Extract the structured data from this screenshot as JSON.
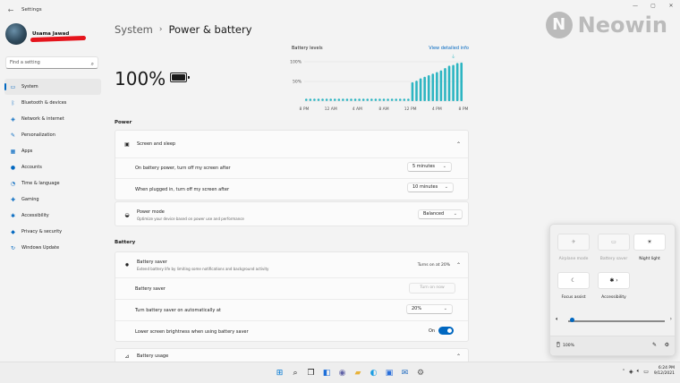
{
  "window": {
    "title": "Settings",
    "back_icon": "back-arrow-icon",
    "controls": [
      "—",
      "▢",
      "✕"
    ]
  },
  "user": {
    "name": "Usama Jawad"
  },
  "search": {
    "placeholder": "Find a setting"
  },
  "nav": {
    "items": [
      {
        "label": "System",
        "icon": "monitor-icon",
        "glyph": "▭",
        "active": true
      },
      {
        "label": "Bluetooth & devices",
        "icon": "bluetooth-icon",
        "glyph": "ᛒ"
      },
      {
        "label": "Network & internet",
        "icon": "wifi-icon",
        "glyph": "◈"
      },
      {
        "label": "Personalization",
        "icon": "brush-icon",
        "glyph": "✎"
      },
      {
        "label": "Apps",
        "icon": "apps-icon",
        "glyph": "▦"
      },
      {
        "label": "Accounts",
        "icon": "person-icon",
        "glyph": "●"
      },
      {
        "label": "Time & language",
        "icon": "clock-icon",
        "glyph": "◔"
      },
      {
        "label": "Gaming",
        "icon": "gamepad-icon",
        "glyph": "✚"
      },
      {
        "label": "Accessibility",
        "icon": "accessibility-icon",
        "glyph": "✱"
      },
      {
        "label": "Privacy & security",
        "icon": "shield-icon",
        "glyph": "◆"
      },
      {
        "label": "Windows Update",
        "icon": "update-icon",
        "glyph": "↻"
      }
    ]
  },
  "header": {
    "parent": "System",
    "separator": "›",
    "current": "Power & battery"
  },
  "battery": {
    "percent": "100%",
    "level": 1.0
  },
  "chart_data": {
    "type": "bar",
    "title": "Battery levels",
    "link": "View detailed info",
    "x_ticks": [
      "8 PM",
      "10 PM",
      "12 AM",
      "2 AM",
      "4 AM",
      "6 AM",
      "8 AM",
      "10 AM",
      "12 PM",
      "2 PM",
      "4 PM",
      "6 PM",
      "8 PM"
    ],
    "visible_x_labels": [
      "8 PM",
      "12 AM",
      "4 AM",
      "8 AM",
      "12 PM",
      "4 PM",
      "8 PM"
    ],
    "y_ticks": [
      "100%",
      "50%"
    ],
    "ylim": [
      0,
      100
    ],
    "values": [
      0,
      0,
      0,
      0,
      0,
      0,
      0,
      0,
      0,
      0,
      0,
      0,
      0,
      0,
      0,
      0,
      0,
      0,
      0,
      0,
      0,
      0,
      0,
      0,
      0,
      0,
      48,
      52,
      58,
      62,
      66,
      70,
      74,
      78,
      84,
      90,
      92,
      97,
      98
    ],
    "bar_color": "#2db5c2",
    "grid": true,
    "plug_marker": "plug-icon"
  },
  "power": {
    "section_label": "Power",
    "screen_sleep": {
      "title": "Screen and sleep",
      "rows": [
        {
          "label": "On battery power, turn off my screen after",
          "value": "5 minutes"
        },
        {
          "label": "When plugged in, turn off my screen after",
          "value": "10 minutes"
        }
      ]
    },
    "power_mode": {
      "title": "Power mode",
      "subtitle": "Optimize your device based on power use and performance",
      "value": "Balanced"
    }
  },
  "battery_section": {
    "section_label": "Battery",
    "saver": {
      "title": "Battery saver",
      "subtitle": "Extend battery life by limiting some notifications and background activity",
      "status": "Turns on at 20%",
      "rows": [
        {
          "label": "Battery saver",
          "button": "Turn on now"
        },
        {
          "label": "Turn battery saver on automatically at",
          "value": "20%"
        },
        {
          "label": "Lower screen brightness when using battery saver",
          "toggle_label": "On"
        }
      ]
    },
    "usage": {
      "title": "Battery usage"
    }
  },
  "quick_settings": {
    "tiles": [
      {
        "label": "Airplane mode",
        "icon": "airplane-icon",
        "glyph": "✈",
        "on": false
      },
      {
        "label": "Battery saver",
        "icon": "battery-saver-icon",
        "glyph": "▭",
        "on": false
      },
      {
        "label": "Night light",
        "icon": "night-light-icon",
        "glyph": "☀",
        "on": true
      },
      {
        "label": "Focus assist",
        "icon": "focus-assist-icon",
        "glyph": "☾",
        "on": true
      },
      {
        "label": "Accessibility",
        "icon": "accessibility-icon",
        "glyph": "✱ ›",
        "on": true
      }
    ],
    "volume_level": 0.02,
    "battery_label": "100%"
  },
  "taskbar": {
    "icons": [
      {
        "name": "start-icon",
        "glyph": "⊞",
        "color": "#0078d4"
      },
      {
        "name": "search-icon",
        "glyph": "⌕",
        "color": "#222222"
      },
      {
        "name": "task-view-icon",
        "glyph": "❐",
        "color": "#222222"
      },
      {
        "name": "widgets-icon",
        "glyph": "◧",
        "color": "#1e6fd9"
      },
      {
        "name": "chat-icon",
        "glyph": "◉",
        "color": "#6264a7"
      },
      {
        "name": "file-explorer-icon",
        "glyph": "▰",
        "color": "#e8b23a"
      },
      {
        "name": "edge-icon",
        "glyph": "◐",
        "color": "#1b9de2"
      },
      {
        "name": "store-icon",
        "glyph": "▣",
        "color": "#2a6fdb"
      },
      {
        "name": "mail-icon",
        "glyph": "✉",
        "color": "#1f6ac0"
      },
      {
        "name": "settings-icon",
        "glyph": "⚙",
        "color": "#5a5a5a"
      }
    ],
    "time": "6:24 PM",
    "date": "9/12/2021"
  },
  "watermark": {
    "text": "Neowin",
    "mark": "N"
  }
}
